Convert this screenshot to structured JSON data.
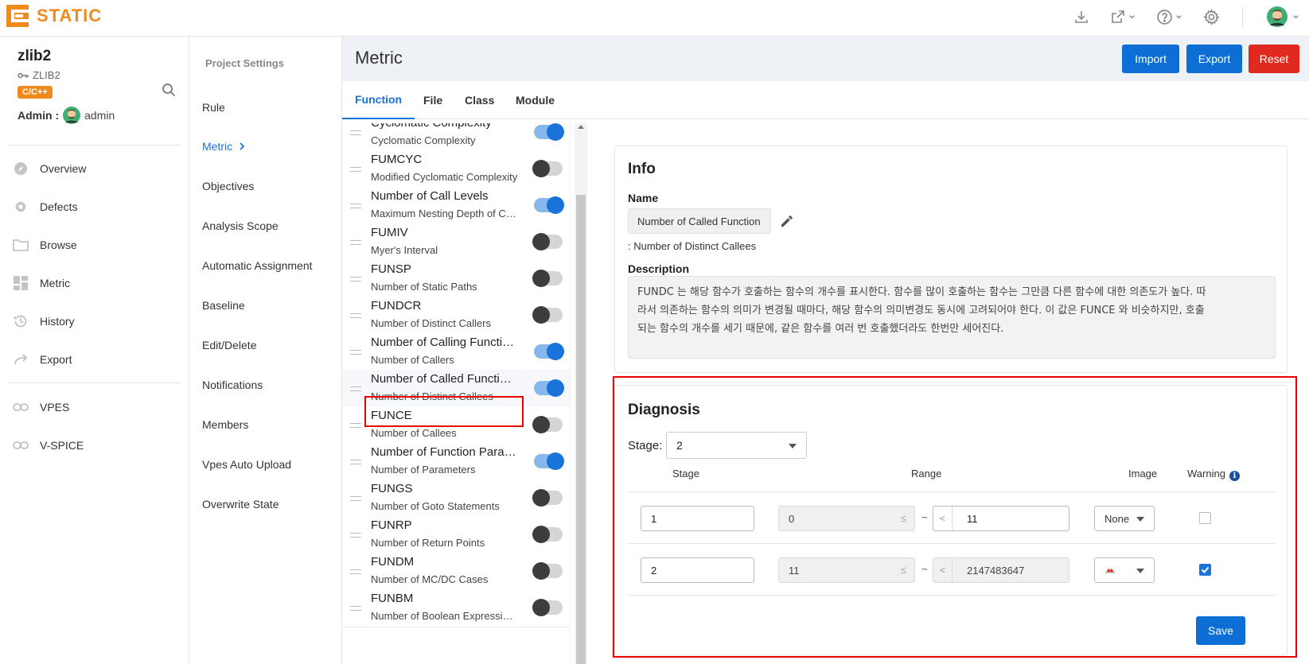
{
  "app": {
    "logo_text": "STATIC",
    "brand_color": "#f08a1c",
    "accent_color": "#1a73d9"
  },
  "project": {
    "name": "zlib2",
    "key": "ZLIB2",
    "language": "C/C++",
    "admin_label": "Admin :",
    "admin_name": "admin"
  },
  "nav": [
    {
      "label": "Overview",
      "icon": "compass-icon"
    },
    {
      "label": "Defects",
      "icon": "gear-icon"
    },
    {
      "label": "Browse",
      "icon": "folder-icon"
    },
    {
      "label": "Metric",
      "icon": "grid-icon"
    },
    {
      "label": "History",
      "icon": "history-icon"
    },
    {
      "label": "Export",
      "icon": "share-arrow-icon"
    },
    {
      "label": "VPES",
      "icon": "link-icon"
    },
    {
      "label": "V-SPICE",
      "icon": "link-icon"
    }
  ],
  "settings": {
    "title": "Project Settings",
    "items": [
      "Rule",
      "Metric",
      "Objectives",
      "Analysis Scope",
      "Automatic Assignment",
      "Baseline",
      "Edit/Delete",
      "Notifications",
      "Members",
      "Vpes Auto Upload",
      "Overwrite State"
    ],
    "active": "Metric"
  },
  "header": {
    "title": "Metric",
    "import_label": "Import",
    "export_label": "Export",
    "reset_label": "Reset"
  },
  "tabs": [
    "Function",
    "File",
    "Class",
    "Module"
  ],
  "metrics": [
    {
      "title": "Cyclomatic Complexity",
      "sub": "Cyclomatic Complexity",
      "on": true
    },
    {
      "title": "FUMCYC",
      "sub": "Modified Cyclomatic Complexity",
      "on": false
    },
    {
      "title": "Number of Call Levels",
      "sub": "Maximum Nesting Depth of Control Structures",
      "on": true
    },
    {
      "title": "FUMIV",
      "sub": "Myer's Interval",
      "on": false
    },
    {
      "title": "FUNSP",
      "sub": "Number of Static Paths",
      "on": false
    },
    {
      "title": "FUNDCR",
      "sub": "Number of Distinct Callers",
      "on": false
    },
    {
      "title": "Number of Calling Functions",
      "sub": "Number of Callers",
      "on": true
    },
    {
      "title": "Number of Called Functions",
      "sub": "Number of Distinct Callees",
      "on": true
    },
    {
      "title": "FUNCE",
      "sub": "Number of Callees",
      "on": false
    },
    {
      "title": "Number of Function Parameters",
      "sub": "Number of Parameters",
      "on": true
    },
    {
      "title": "FUNGS",
      "sub": "Number of Goto Statements",
      "on": false
    },
    {
      "title": "FUNRP",
      "sub": "Number of Return Points",
      "on": false
    },
    {
      "title": "FUNDM",
      "sub": "Number of MC/DC Cases",
      "on": false
    },
    {
      "title": "FUNBM",
      "sub": "Number of Boolean Expressions",
      "on": false
    }
  ],
  "info": {
    "title": "Info",
    "name_label": "Name",
    "name_value": "Number of Called Function",
    "name_desc": ": Number of Distinct Callees",
    "desc_label": "Description",
    "desc_lines": [
      "FUNDC 는 해당 함수가 호출하는 함수의 개수를 표시한다. 함수를 많이 호출하는 함수는 그만큼 다른 함수에 대한 의존도가 높다. 따",
      "라서 의존하는 함수의 의미가 변경될 때마다, 해당 함수의 의미변경도 동시에 고려되어야 한다. 이 값은 FUNCE 와 비슷하지만, 호출",
      "되는 함수의 개수를 세기 때문에, 같은 함수를 여러 번 호출했더라도 한번만 세어진다."
    ]
  },
  "diagnosis": {
    "title": "Diagnosis",
    "stage_label": "Stage:",
    "stage_value": "2",
    "headers": {
      "stage": "Stage",
      "range": "Range",
      "image": "Image",
      "warning": "Warning"
    },
    "le": "≤",
    "tilde": "~",
    "lt": "<",
    "rows": [
      {
        "stage": "1",
        "min": "0",
        "max": "11",
        "image": "None",
        "warning": false
      },
      {
        "stage": "2",
        "min": "11",
        "max": "2147483647",
        "image": "",
        "warning": true
      }
    ],
    "save_label": "Save"
  }
}
